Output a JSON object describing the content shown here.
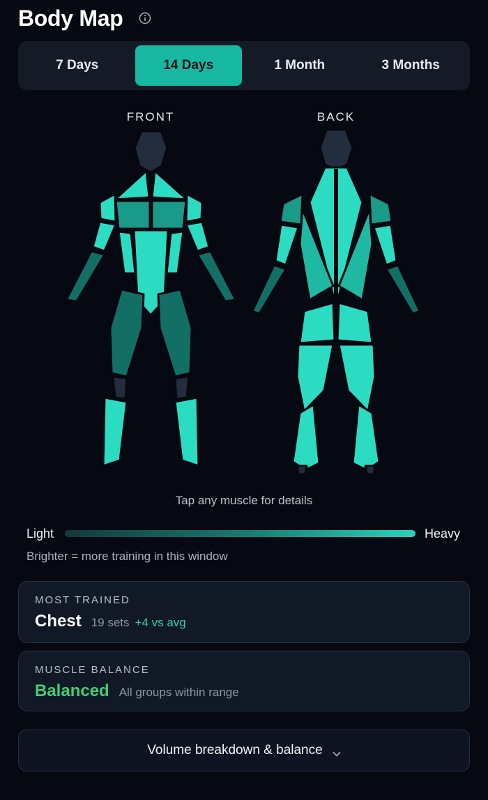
{
  "header": {
    "title": "Body Map",
    "info_icon": "info-icon"
  },
  "tabs": [
    {
      "label": "7 Days",
      "active": false
    },
    {
      "label": "14 Days",
      "active": true
    },
    {
      "label": "1 Month",
      "active": false
    },
    {
      "label": "3 Months",
      "active": false
    }
  ],
  "body_map": {
    "front_label": "FRONT",
    "back_label": "BACK",
    "intensity_colors": {
      "none": "#232d3d",
      "light": "#136f66",
      "medium": "#1fb9a2",
      "heavy": "#2bdcc3"
    },
    "hint": "Tap any muscle for details"
  },
  "legend": {
    "light": "Light",
    "heavy": "Heavy",
    "note": "Brighter = more training in this window"
  },
  "most_trained": {
    "label": "MOST TRAINED",
    "muscle": "Chest",
    "sets": "19 sets",
    "delta": "+4 vs avg"
  },
  "muscle_balance": {
    "label": "MUSCLE BALANCE",
    "status": "Balanced",
    "detail": "All groups within range"
  },
  "expand": {
    "label": "Volume breakdown & balance",
    "icon": "chevron-down-icon"
  },
  "colors": {
    "accent": "#17b8a2",
    "background": "#060912",
    "card": "#111826",
    "positive": "#3fcf72"
  }
}
